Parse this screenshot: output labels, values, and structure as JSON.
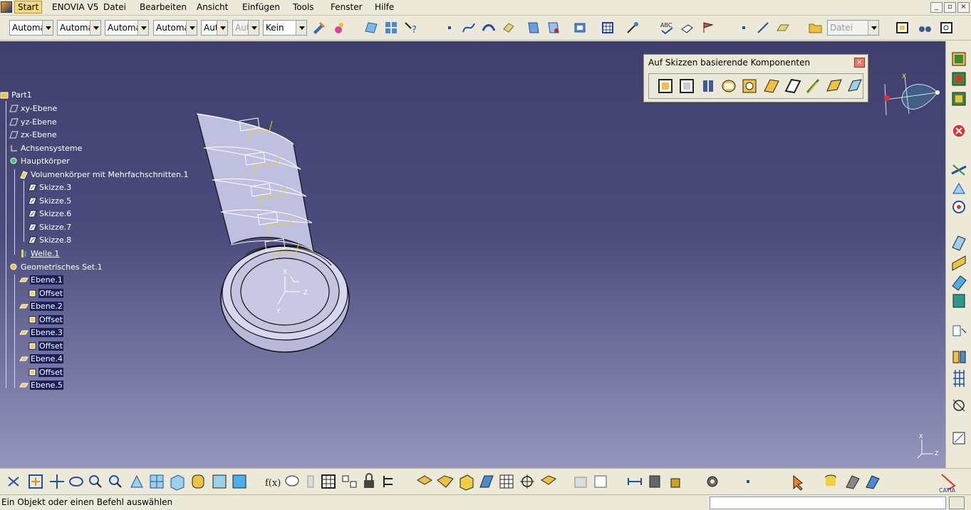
{
  "menu": {
    "items": [
      "Start",
      "ENOVIA V5",
      "Datei",
      "Bearbeiten",
      "Ansicht",
      "Einfügen",
      "Tools",
      "Fenster",
      "Hilfe"
    ]
  },
  "toolbar": {
    "combos": [
      "Automa",
      "Automa",
      "Automa",
      "Automa",
      "Aut",
      "Aut",
      "Kein",
      "Datei"
    ]
  },
  "tree": {
    "nodes": [
      "Part1",
      "xy-Ebene",
      "yz-Ebene",
      "zx-Ebene",
      "Achsensysteme",
      "Hauptkörper",
      "Volumenkörper mit Mehrfachschnitten.1",
      "Skizze.3",
      "Skizze.5",
      "Skizze.6",
      "Skizze.7",
      "Skizze.8",
      "Welle.1",
      "Geometrisches Set.1",
      "Ebene.1",
      "Offset",
      "Ebene.2",
      "Offset",
      "Ebene.3",
      "Offset",
      "Ebene.4",
      "Offset",
      "Ebene.5"
    ]
  },
  "floating_toolbar": {
    "title": "Auf Skizzen basierende Komponenten",
    "close": "×"
  },
  "window_buttons": [
    "_",
    "▫",
    "×"
  ],
  "axes": {
    "x": "X",
    "y": "Y",
    "z": "Z"
  },
  "status": {
    "text": "Ein Objekt oder einen Befehl auswählen"
  },
  "colors": {
    "viewport_top": "#3f3f6f",
    "viewport_bottom": "#9595bb",
    "sketch_yellow": "#e6d31e",
    "selection": "#1a1e5c"
  }
}
